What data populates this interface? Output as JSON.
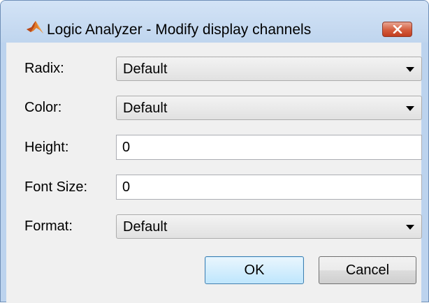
{
  "window": {
    "title": "Logic Analyzer - Modify display channels",
    "app_icon": "matlab-logo-icon",
    "close_icon": "close-icon"
  },
  "form": {
    "radix": {
      "label": "Radix:",
      "value": "Default"
    },
    "color": {
      "label": "Color:",
      "value": "Default"
    },
    "height": {
      "label": "Height:",
      "value": "0"
    },
    "font_size": {
      "label": "Font Size:",
      "value": "0"
    },
    "format": {
      "label": "Format:",
      "value": "Default"
    }
  },
  "buttons": {
    "ok_label": "OK",
    "cancel_label": "Cancel"
  },
  "colors": {
    "frame": "#bcd3ee",
    "client": "#f0f0f0",
    "close_button": "#c94b2d",
    "ok_border": "#3c7fb1"
  }
}
